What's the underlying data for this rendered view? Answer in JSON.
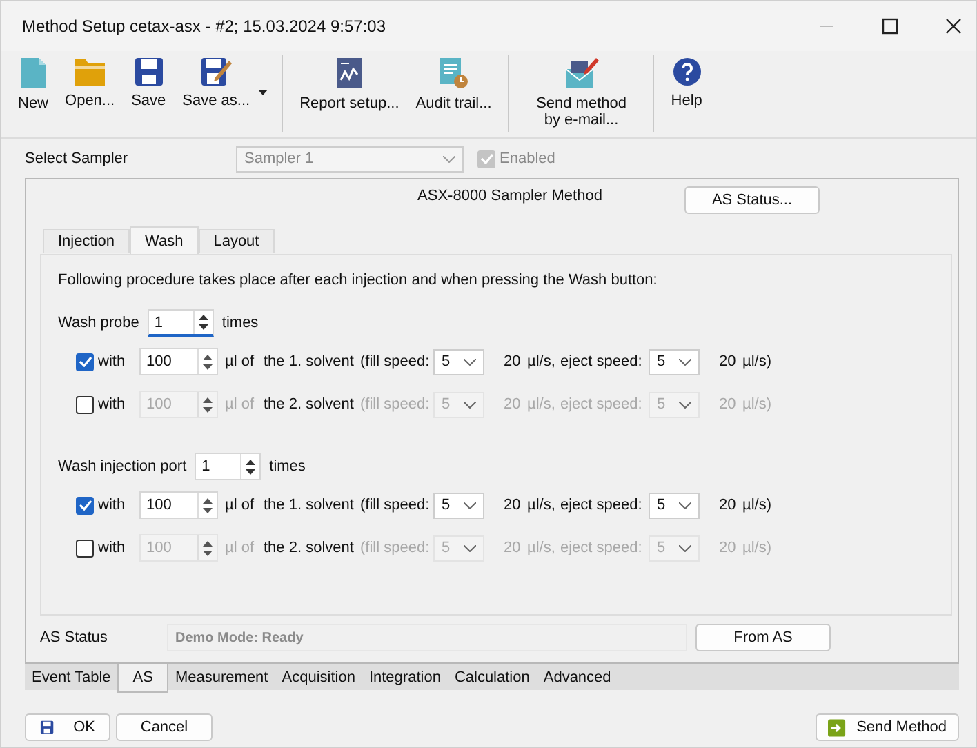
{
  "window": {
    "title": "Method Setup cetax-asx - #2;   15.03.2024   9:57:03"
  },
  "toolbar": [
    [
      {
        "label": "New"
      },
      {
        "label": "Open..."
      },
      {
        "label": "Save"
      },
      {
        "label": "Save as...",
        "has_menu": true
      }
    ],
    [
      {
        "label": "Report setup..."
      },
      {
        "label": "Audit trail..."
      }
    ],
    [
      {
        "label": "Send method by e-mail..."
      }
    ],
    [
      {
        "label": "Help"
      }
    ]
  ],
  "sampler": {
    "label": "Select Sampler",
    "value": "Sampler 1",
    "disabled": true,
    "enabled_label": "Enabled",
    "enabled_checked": true
  },
  "method": {
    "title": "ASX-8000 Sampler Method",
    "status_button": "AS Status..."
  },
  "tabs": [
    {
      "label": "Injection",
      "selected": false
    },
    {
      "label": "Wash",
      "selected": true
    },
    {
      "label": "Layout",
      "selected": false
    }
  ],
  "description": "Following procedure takes place after each injection and when pressing the Wash button:",
  "sections": [
    {
      "label": "Wash probe",
      "count": "1",
      "focused": true,
      "suffix": "times",
      "rows": [
        {
          "checked": true,
          "label": "with",
          "volume": "100",
          "unit": "µl of",
          "solvent": "the 1. solvent",
          "fill_label": "(fill speed:",
          "fill_value": "5",
          "fill_rate": "20",
          "fill_unit": "µl/s,",
          "eject_label": "eject speed:",
          "eject_value": "5",
          "eject_rate": "20",
          "eject_unit": "µl/s)"
        },
        {
          "checked": false,
          "label": "with",
          "volume": "100",
          "unit": "µl of",
          "solvent": "the 2. solvent",
          "fill_label": "(fill speed:",
          "fill_value": "5",
          "fill_rate": "20",
          "fill_unit": "µl/s,",
          "eject_label": "eject speed:",
          "eject_value": "5",
          "eject_rate": "20",
          "eject_unit": "µl/s)"
        }
      ]
    },
    {
      "label": "Wash injection port",
      "count": "1",
      "focused": false,
      "suffix": "times",
      "rows": [
        {
          "checked": true,
          "label": "with",
          "volume": "100",
          "unit": "µl of",
          "solvent": "the 1. solvent",
          "fill_label": "(fill speed:",
          "fill_value": "5",
          "fill_rate": "20",
          "fill_unit": "µl/s,",
          "eject_label": "eject speed:",
          "eject_value": "5",
          "eject_rate": "20",
          "eject_unit": "µl/s)"
        },
        {
          "checked": false,
          "label": "with",
          "volume": "100",
          "unit": "µl of",
          "solvent": "the 2. solvent",
          "fill_label": "(fill speed:",
          "fill_value": "5",
          "fill_rate": "20",
          "fill_unit": "µl/s,",
          "eject_label": "eject speed:",
          "eject_value": "5",
          "eject_rate": "20",
          "eject_unit": "µl/s)"
        }
      ]
    }
  ],
  "as_status": {
    "label": "AS Status",
    "value": "Demo Mode: Ready",
    "button": "From AS"
  },
  "bottom_tabs": [
    {
      "label": "Event Table",
      "selected": false
    },
    {
      "label": "AS",
      "selected": true
    },
    {
      "label": "Measurement",
      "selected": false
    },
    {
      "label": "Acquisition",
      "selected": false
    },
    {
      "label": "Integration",
      "selected": false
    },
    {
      "label": "Calculation",
      "selected": false
    },
    {
      "label": "Advanced",
      "selected": false
    }
  ],
  "footer": {
    "ok": "OK",
    "cancel": "Cancel",
    "send": "Send Method"
  }
}
